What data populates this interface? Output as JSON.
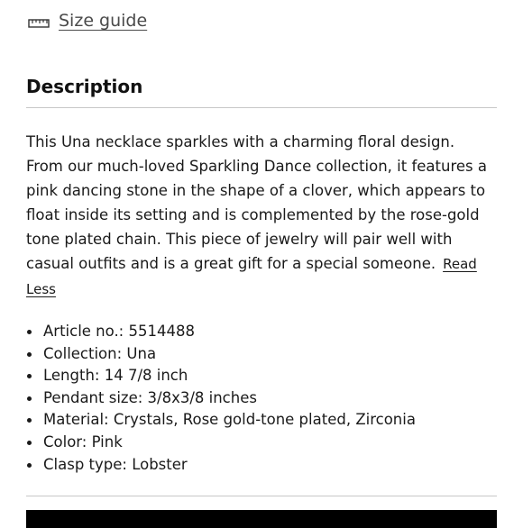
{
  "size_guide": {
    "label": "Size guide",
    "icon": "ruler-icon"
  },
  "description": {
    "title": "Description",
    "body": "This Una necklace sparkles with a charming floral design. From our much-loved Sparkling Dance collection, it features a pink dancing stone in the shape of a clover, which appears to float inside its setting and is complemented by the rose-gold tone plated chain. This piece of jewelry will pair well with casual outfits and is a great gift for a special someone.",
    "read_less": "Read Less"
  },
  "specs": [
    "Article no.: 5514488",
    "Collection:  Una",
    "Length: 14 7/8 inch",
    "Pendant size: 3/8x3/8 inches",
    "Material:  Crystals, Rose gold-tone plated, Zirconia",
    "Color:  Pink",
    "Clasp type:  Lobster"
  ],
  "colors": {
    "text": "#1a1a1a",
    "divider": "#c8c8c8",
    "cta_bar": "#000000"
  }
}
